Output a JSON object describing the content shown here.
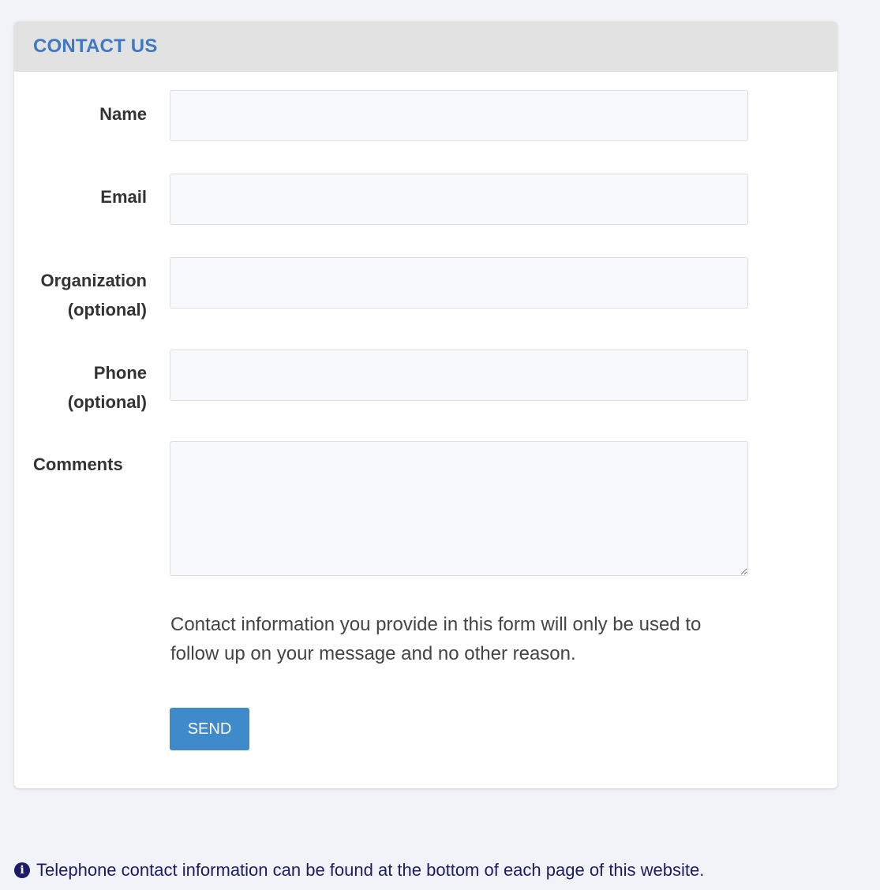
{
  "panel": {
    "title": "CONTACT US"
  },
  "form": {
    "name_label": "Name",
    "name_value": "",
    "email_label": "Email",
    "email_value": "",
    "organization_label_line1": "Organization",
    "organization_label_line2": "(optional)",
    "organization_value": "",
    "phone_label_line1": "Phone",
    "phone_label_line2": "(optional)",
    "phone_value": "",
    "comments_label": "Comments",
    "comments_value": "",
    "notice": "Contact information you provide in this form will only be used to follow up on your message and no other reason.",
    "send_label": "SEND"
  },
  "footer": {
    "icon": "info-icon",
    "note": "Telephone contact information can be found at the bottom of each page of this website."
  },
  "colors": {
    "title": "#3f78c4",
    "button": "#3f8acb",
    "footer_text": "#1a1c6b"
  }
}
